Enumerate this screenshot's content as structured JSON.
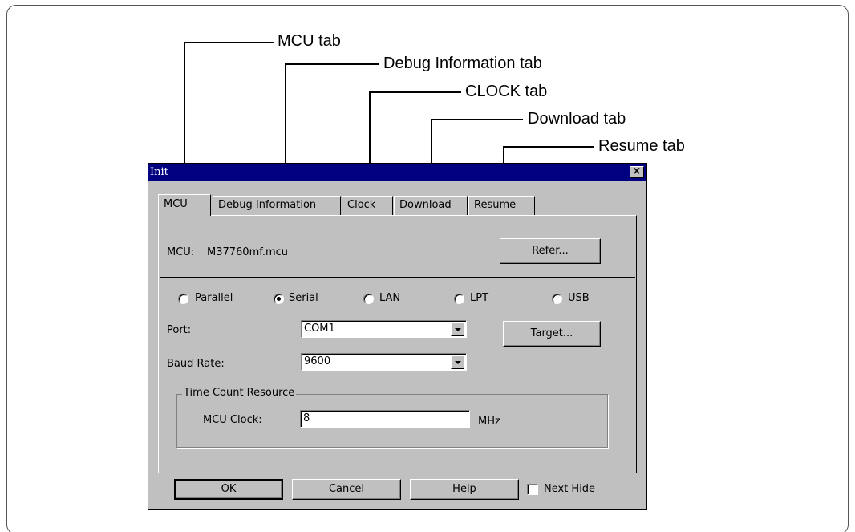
{
  "callouts": {
    "mcu_tab": "MCU tab",
    "debug_tab": "Debug Information tab",
    "clock_tab": "CLOCK tab",
    "download_tab": "Download tab",
    "resume_tab": "Resume tab"
  },
  "dialog": {
    "title": "Init",
    "close_icon": "×",
    "tabs": [
      "MCU",
      "Debug Information",
      "Clock",
      "Download",
      "Resume"
    ],
    "mcu_label": "MCU:",
    "mcu_value": "M37760mf.mcu",
    "refer_button": "Refer...",
    "radios": [
      "Parallel",
      "Serial",
      "LAN",
      "LPT",
      "USB"
    ],
    "selected_radio": "Serial",
    "port_label": "Port:",
    "port_value": "COM1",
    "target_button": "Target...",
    "baud_label": "Baud Rate:",
    "baud_value": "9600",
    "group_title": "Time Count Resource",
    "clock_label": "MCU Clock:",
    "clock_value": "8",
    "clock_unit": "MHz",
    "ok_button": "OK",
    "cancel_button": "Cancel",
    "help_button": "Help",
    "next_hide_label": "Next Hide",
    "next_hide_checked": false
  }
}
